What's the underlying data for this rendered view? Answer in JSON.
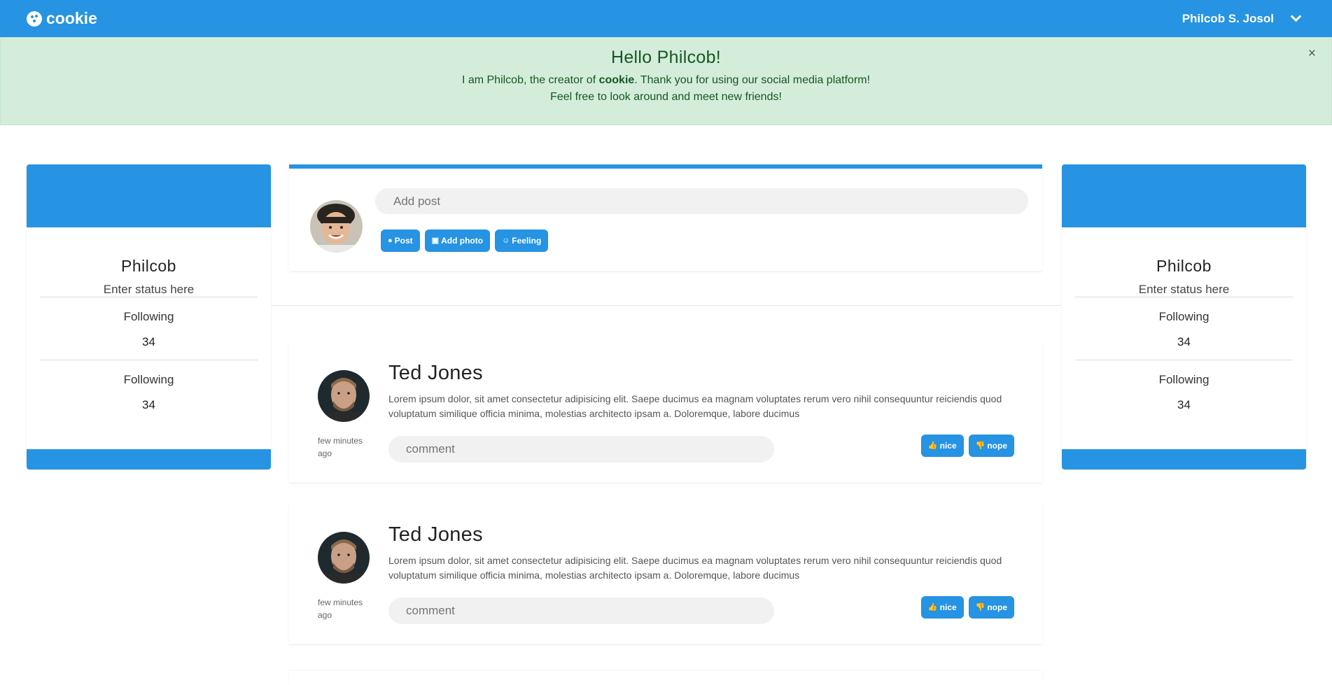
{
  "navbar": {
    "brand": "cookie",
    "user_name": "Philcob S. Josol"
  },
  "alert": {
    "title": "Hello Philcob!",
    "line1_before": "I am Philcob, the creator of ",
    "line1_bold": "cookie",
    "line1_after": ". Thank you for using our social media platform!",
    "line2": "Feel free to look around and meet new friends!",
    "close": "×"
  },
  "profile_card": {
    "name": "Philcob",
    "status": "Enter status here",
    "stats": [
      {
        "label": "Following",
        "value": "34"
      },
      {
        "label": "Following",
        "value": "34"
      }
    ]
  },
  "compose": {
    "placeholder": "Add post",
    "post_label": "Post",
    "add_photo_label": "Add photo",
    "feeling_label": "Feeling"
  },
  "posts": [
    {
      "author": "Ted Jones",
      "body": "Lorem ipsum dolor, sit amet consectetur adipisicing elit. Saepe ducimus ea magnam voluptates rerum vero nihil consequuntur reiciendis quod voluptatum similique officia minima, molestias architecto ipsam a. Doloremque, labore ducimus",
      "time": "few minutes ago",
      "comment_placeholder": "comment",
      "nice_label": "nice",
      "nope_label": "nope"
    },
    {
      "author": "Ted Jones",
      "body": "Lorem ipsum dolor, sit amet consectetur adipisicing elit. Saepe ducimus ea magnam voluptates rerum vero nihil consequuntur reiciendis quod voluptatum similique officia minima, molestias architecto ipsam a. Doloremque, labore ducimus",
      "time": "few minutes ago",
      "comment_placeholder": "comment",
      "nice_label": "nice",
      "nope_label": "nope"
    }
  ],
  "colors": {
    "primary": "#2693e3",
    "alert_bg": "#d4edda",
    "alert_text": "#155724"
  },
  "icons": [
    "cookie-icon",
    "chevron-down-icon",
    "close-icon",
    "cookie-post-icon",
    "image-icon",
    "smile-icon",
    "thumbs-up-icon",
    "thumbs-down-icon"
  ]
}
